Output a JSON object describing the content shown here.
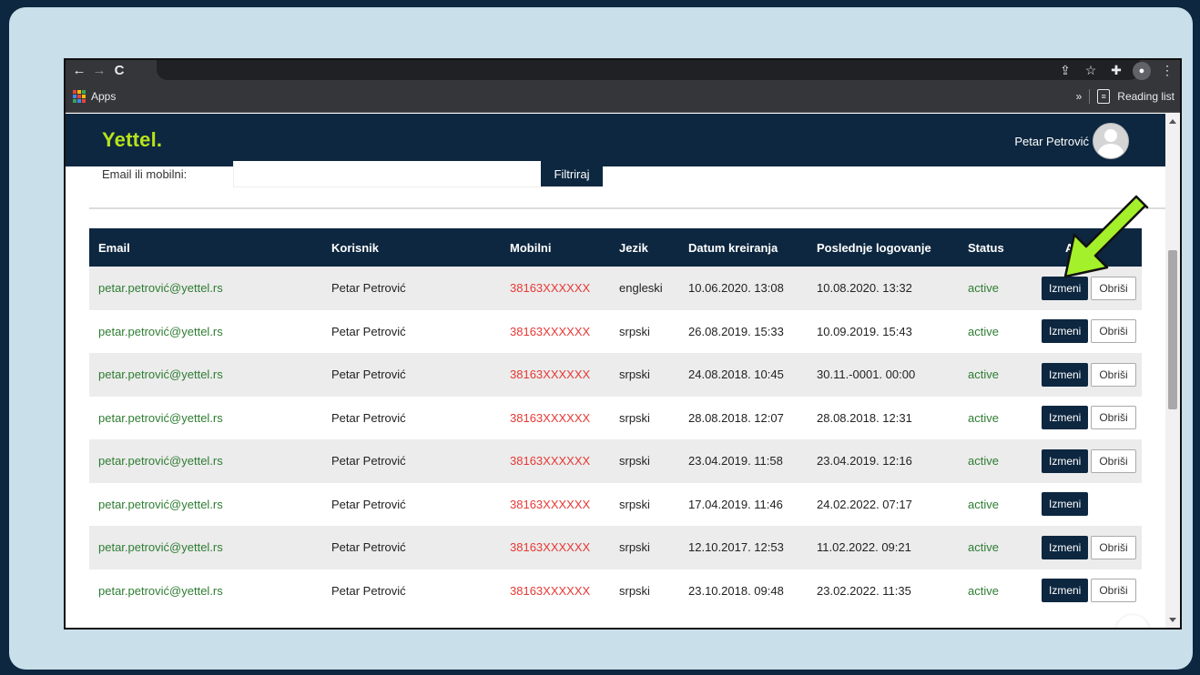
{
  "browser": {
    "nav": {
      "back_icon": "←",
      "forward_icon": "→",
      "reload_icon": "C"
    },
    "toolbar_icons": [
      "share-icon",
      "star-icon",
      "extensions-icon",
      "profile-icon",
      "menu-icon"
    ],
    "bookmarks": {
      "apps_label": "Apps",
      "overflow": "»",
      "reading_list_label": "Reading list"
    }
  },
  "site": {
    "logo": "Yettel.",
    "user_name": "Petar Petrović",
    "filter": {
      "label": "Email ili mobilni:",
      "value": "",
      "button_label": "Filtriraj"
    },
    "table": {
      "columns": [
        "Email",
        "Korisnik",
        "Mobilni",
        "Jezik",
        "Datum kreiranja",
        "Poslednje logovanje",
        "Status",
        "A"
      ],
      "edit_label": "Izmeni",
      "delete_label": "Obriši",
      "rows": [
        {
          "email": "petar.petrović@yettel.rs",
          "user": "Petar Petrović",
          "mobile": "38163XXXXXX",
          "lang": "engleski",
          "created": "10.06.2020. 13:08",
          "last_login": "10.08.2020. 13:32",
          "status": "active",
          "can_delete": true
        },
        {
          "email": "petar.petrović@yettel.rs",
          "user": "Petar Petrović",
          "mobile": "38163XXXXXX",
          "lang": "srpski",
          "created": "26.08.2019. 15:33",
          "last_login": "10.09.2019. 15:43",
          "status": "active",
          "can_delete": true
        },
        {
          "email": "petar.petrović@yettel.rs",
          "user": "Petar Petrović",
          "mobile": "38163XXXXXX",
          "lang": "srpski",
          "created": "24.08.2018. 10:45",
          "last_login": "30.11.-0001. 00:00",
          "status": "active",
          "can_delete": true
        },
        {
          "email": "petar.petrović@yettel.rs",
          "user": "Petar Petrović",
          "mobile": "38163XXXXXX",
          "lang": "srpski",
          "created": "28.08.2018. 12:07",
          "last_login": "28.08.2018. 12:31",
          "status": "active",
          "can_delete": true
        },
        {
          "email": "petar.petrović@yettel.rs",
          "user": "Petar Petrović",
          "mobile": "38163XXXXXX",
          "lang": "srpski",
          "created": "23.04.2019. 11:58",
          "last_login": "23.04.2019. 12:16",
          "status": "active",
          "can_delete": true
        },
        {
          "email": "petar.petrović@yettel.rs",
          "user": "Petar Petrović",
          "mobile": "38163XXXXXX",
          "lang": "srpski",
          "created": "17.04.2019. 11:46",
          "last_login": "24.02.2022. 07:17",
          "status": "active",
          "can_delete": false
        },
        {
          "email": "petar.petrović@yettel.rs",
          "user": "Petar Petrović",
          "mobile": "38163XXXXXX",
          "lang": "srpski",
          "created": "12.10.2017. 12:53",
          "last_login": "11.02.2022. 09:21",
          "status": "active",
          "can_delete": true
        },
        {
          "email": "petar.petrović@yettel.rs",
          "user": "Petar Petrović",
          "mobile": "38163XXXXXX",
          "lang": "srpski",
          "created": "23.10.2018. 09:48",
          "last_login": "23.02.2022. 11:35",
          "status": "active",
          "can_delete": true
        }
      ]
    },
    "back_to_top_icon": "↑"
  },
  "colors": {
    "navy": "#0d2740",
    "brand_green": "#b7e31c",
    "email_green": "#2e7d32",
    "mobile_red": "#e53935",
    "annotation_arrow": "#a4f02a"
  }
}
